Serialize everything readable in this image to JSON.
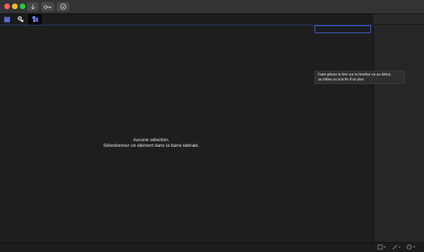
{
  "window": {
    "traffic_lights": [
      "close",
      "minimize",
      "maximize"
    ]
  },
  "titlebar_buttons": [
    {
      "icon": "download-arrow-icon"
    },
    {
      "icon": "key-icon"
    },
    {
      "icon": "checkmark-circle-icon"
    }
  ],
  "toolbar": {
    "tools": [
      {
        "icon": "clapperboard-icon"
      },
      {
        "icon": "film-reel-icon"
      },
      {
        "icon": "shapes-icon"
      }
    ]
  },
  "empty_state": {
    "line1": "Aucune sélection.",
    "line2": "Sélectionnez un élément dans la barre latérale."
  },
  "tooltip": {
    "line1": "Faire glisser le titre sur la timeline ou au début,",
    "line2": "au milieu ou à la fin d’un plan"
  },
  "bottombar": {
    "items": [
      {
        "icon": "crop-icon"
      },
      {
        "icon": "magic-wand-icon"
      },
      {
        "icon": "speed-gauge-icon"
      }
    ]
  },
  "colors": {
    "accent": "#3f62c8",
    "background": "#1e1e1e"
  }
}
